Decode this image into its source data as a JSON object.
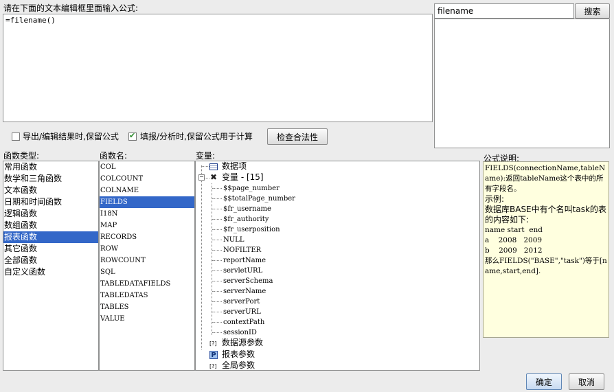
{
  "editor": {
    "prompt_label": "请在下面的文本编辑框里面输入公式:",
    "formula": "=filename()"
  },
  "search": {
    "value": "filename",
    "button_label": "搜索"
  },
  "options": {
    "keep_formula_on_export_label": "导出/编辑结果时,保留公式",
    "keep_formula_on_export_checked": false,
    "keep_formula_on_fill_label": "填报/分析时,保留公式用于计算",
    "keep_formula_on_fill_checked": true,
    "check_validity_label": "检查合法性"
  },
  "function_types": {
    "header": "函数类型:",
    "selected": "报表函数",
    "items": [
      "常用函数",
      "数学和三角函数",
      "文本函数",
      "日期和时间函数",
      "逻辑函数",
      "数组函数",
      "报表函数",
      "其它函数",
      "全部函数",
      "自定义函数"
    ]
  },
  "function_names": {
    "header": "函数名:",
    "selected": "FIELDS",
    "items": [
      "COL",
      "COLCOUNT",
      "COLNAME",
      "FIELDS",
      "I18N",
      "MAP",
      "RECORDS",
      "ROW",
      "ROWCOUNT",
      "SQL",
      "TABLEDATAFIELDS",
      "TABLEDATAS",
      "TABLES",
      "VALUE"
    ]
  },
  "variables": {
    "header": "变量:",
    "data_item_label": "数据项",
    "variable_label": "变量 - [15]",
    "variable_items": [
      "$$page_number",
      "$$totalPage_number",
      "$fr_username",
      "$fr_authority",
      "$fr_userposition",
      "NULL",
      "NOFILTER",
      "reportName",
      "servletURL",
      "serverSchema",
      "serverName",
      "serverPort",
      "serverURL",
      "contextPath",
      "sessionID"
    ],
    "datasource_params_label": "数据源参数",
    "report_params_label": "报表参数",
    "global_params_label": "全局参数"
  },
  "description": {
    "header": "公式说明:",
    "signature": "FIELDS(connectionName,tableName):返回tableName这个表中的所有字段名。",
    "example_label": "示例:",
    "example_text": "数据库BASE中有个名叫task的表的内容如下:",
    "table_header": "name start  end",
    "table_row1": "a    2008   2009",
    "table_row2": "b    2009   2012",
    "conclusion": "那么FIELDS(\"BASE\",\"task\")等于[name,start,end]."
  },
  "footer": {
    "ok_label": "确定",
    "cancel_label": "取消"
  },
  "colors": {
    "selection": "#3367c8",
    "description_bg": "#ffffdf"
  }
}
